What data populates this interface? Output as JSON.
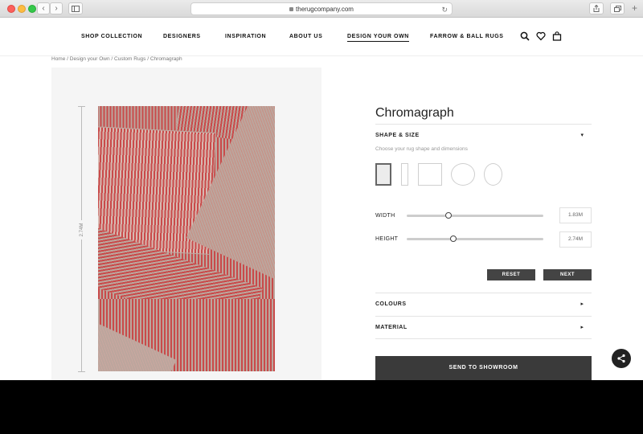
{
  "browser": {
    "url": "therugcompany.com",
    "back_icon": "chevron-left-icon",
    "forward_icon": "chevron-right-icon"
  },
  "nav": {
    "items": [
      "SHOP COLLECTION",
      "DESIGNERS",
      "INSPIRATION",
      "ABOUT US",
      "DESIGN YOUR OWN",
      "FARROW & BALL RUGS"
    ],
    "active": "DESIGN YOUR OWN",
    "icons": [
      "search-icon",
      "heart-icon",
      "bag-icon"
    ]
  },
  "breadcrumb": [
    "Home",
    "Design your Own",
    "Custom Rugs",
    "Chromagraph"
  ],
  "preview": {
    "dimension_label": "2.74M",
    "colors": {
      "red": "#c94a4a",
      "taupe": "#bca69d"
    }
  },
  "product": {
    "title": "Chromagraph",
    "shape_section": "SHAPE & SIZE",
    "shape_hint": "Choose your rug shape and dimensions",
    "shapes": [
      "rectangle",
      "runner",
      "square",
      "circle",
      "oval"
    ],
    "selected_shape": "rectangle",
    "width_label": "WIDTH",
    "width_value": "1.83M",
    "height_label": "HEIGHT",
    "height_value": "2.74M",
    "reset_label": "RESET",
    "next_label": "NEXT",
    "colours_section": "COLOURS",
    "material_section": "MATERIAL",
    "send_label": "SEND TO SHOWROOM"
  }
}
